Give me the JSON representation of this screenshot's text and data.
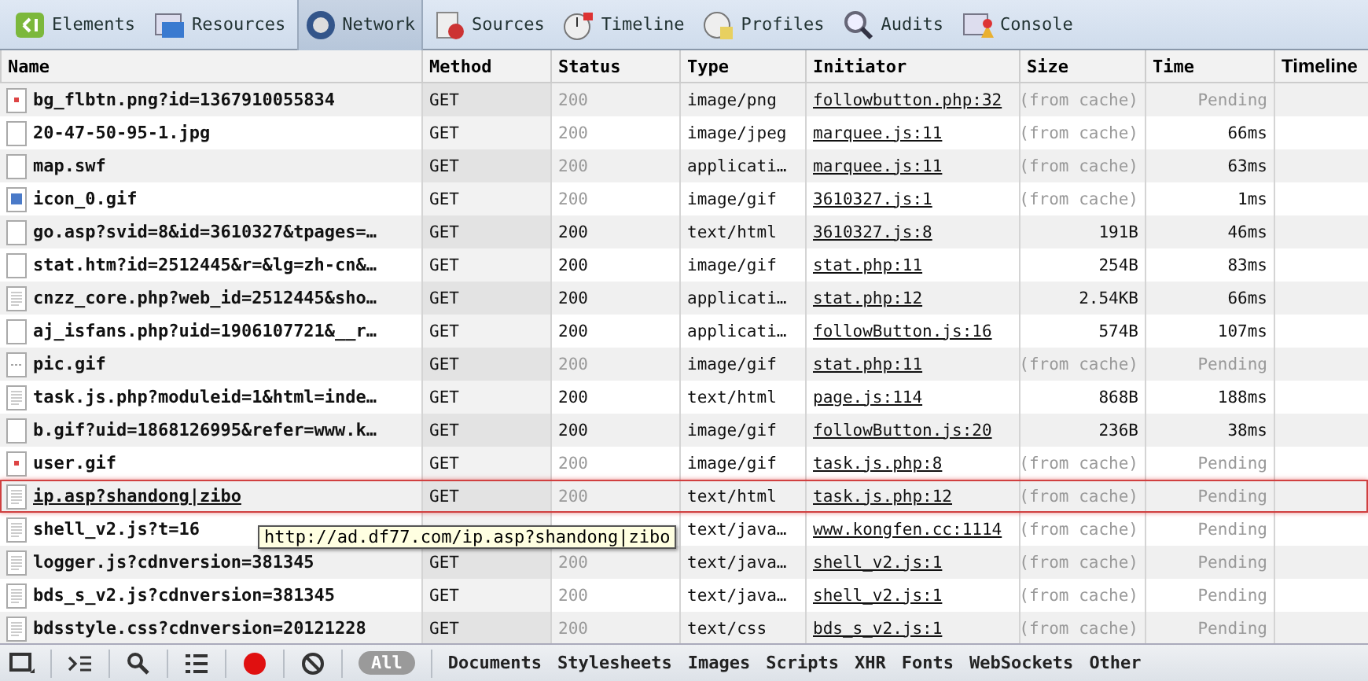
{
  "tabs": [
    {
      "label": "Elements",
      "selected": false
    },
    {
      "label": "Resources",
      "selected": false
    },
    {
      "label": "Network",
      "selected": true
    },
    {
      "label": "Sources",
      "selected": false
    },
    {
      "label": "Timeline",
      "selected": false
    },
    {
      "label": "Profiles",
      "selected": false
    },
    {
      "label": "Audits",
      "selected": false
    },
    {
      "label": "Console",
      "selected": false
    }
  ],
  "table": {
    "columns": [
      "Name",
      "Method",
      "Status",
      "Type",
      "Initiator",
      "Size",
      "Time",
      "Timeline"
    ],
    "rows": [
      {
        "kind": "image",
        "name": "bg_flbtn.png?id=1367910055834",
        "method": "GET",
        "status": "200",
        "type": "image/png",
        "initiator": "followbutton.php:32",
        "size": "(from cache)",
        "time": "Pending",
        "from_cache": true,
        "pending": true,
        "selected": false
      },
      {
        "kind": "blank",
        "name": "20-47-50-95-1.jpg",
        "method": "GET",
        "status": "200",
        "type": "image/jpeg",
        "initiator": "marquee.js:11",
        "size": "(from cache)",
        "time": "66ms",
        "from_cache": true,
        "pending": false,
        "selected": false
      },
      {
        "kind": "blank",
        "name": "map.swf",
        "method": "GET",
        "status": "200",
        "type": "applicati…",
        "initiator": "marquee.js:11",
        "size": "(from cache)",
        "time": "63ms",
        "from_cache": true,
        "pending": false,
        "selected": false
      },
      {
        "kind": "picture",
        "name": "icon_0.gif",
        "method": "GET",
        "status": "200",
        "type": "image/gif",
        "initiator": "3610327.js:1",
        "size": "(from cache)",
        "time": "1ms",
        "from_cache": true,
        "pending": false,
        "selected": false
      },
      {
        "kind": "blank",
        "name": "go.asp?svid=8&id=3610327&tpages=…",
        "method": "GET",
        "status": "200",
        "type": "text/html",
        "initiator": "3610327.js:8",
        "size": "191B",
        "time": "46ms",
        "from_cache": false,
        "pending": false,
        "selected": false
      },
      {
        "kind": "blank",
        "name": "stat.htm?id=2512445&r=&lg=zh-cn&…",
        "method": "GET",
        "status": "200",
        "type": "image/gif",
        "initiator": "stat.php:11",
        "size": "254B",
        "time": "83ms",
        "from_cache": false,
        "pending": false,
        "selected": false
      },
      {
        "kind": "document",
        "name": "cnzz_core.php?web_id=2512445&sho…",
        "method": "GET",
        "status": "200",
        "type": "applicati…",
        "initiator": "stat.php:12",
        "size": "2.54KB",
        "time": "66ms",
        "from_cache": false,
        "pending": false,
        "selected": false
      },
      {
        "kind": "blank",
        "name": "aj_isfans.php?uid=1906107721&__r…",
        "method": "GET",
        "status": "200",
        "type": "applicati…",
        "initiator": "followButton.js:16",
        "size": "574B",
        "time": "107ms",
        "from_cache": false,
        "pending": false,
        "selected": false
      },
      {
        "kind": "dash",
        "name": "pic.gif",
        "method": "GET",
        "status": "200",
        "type": "image/gif",
        "initiator": "stat.php:11",
        "size": "(from cache)",
        "time": "Pending",
        "from_cache": true,
        "pending": true,
        "selected": false
      },
      {
        "kind": "document",
        "name": "task.js.php?moduleid=1&html=inde…",
        "method": "GET",
        "status": "200",
        "type": "text/html",
        "initiator": "page.js:114",
        "size": "868B",
        "time": "188ms",
        "from_cache": false,
        "pending": false,
        "selected": false
      },
      {
        "kind": "blank",
        "name": "b.gif?uid=1868126995&refer=www.k…",
        "method": "GET",
        "status": "200",
        "type": "image/gif",
        "initiator": "followButton.js:20",
        "size": "236B",
        "time": "38ms",
        "from_cache": false,
        "pending": false,
        "selected": false
      },
      {
        "kind": "image",
        "name": "user.gif",
        "method": "GET",
        "status": "200",
        "type": "image/gif",
        "initiator": "task.js.php:8",
        "size": "(from cache)",
        "time": "Pending",
        "from_cache": true,
        "pending": true,
        "selected": false
      },
      {
        "kind": "document",
        "name": "ip.asp?shandong|zibo",
        "method": "GET",
        "status": "200",
        "type": "text/html",
        "initiator": "task.js.php:12",
        "size": "(from cache)",
        "time": "Pending",
        "from_cache": true,
        "pending": true,
        "selected": true
      },
      {
        "kind": "document",
        "name": "shell_v2.js?t=16",
        "type": "text/java…",
        "initiator": "www.kongfen.cc:1114",
        "size": "(from cache)",
        "time": "Pending",
        "from_cache": true,
        "pending": true,
        "selected": false
      },
      {
        "kind": "document",
        "name": "logger.js?cdnversion=381345",
        "method": "GET",
        "status": "200",
        "type": "text/java…",
        "initiator": "shell_v2.js:1",
        "size": "(from cache)",
        "time": "Pending",
        "from_cache": true,
        "pending": true,
        "selected": false
      },
      {
        "kind": "document",
        "name": "bds_s_v2.js?cdnversion=381345",
        "method": "GET",
        "status": "200",
        "type": "text/java…",
        "initiator": "shell_v2.js:1",
        "size": "(from cache)",
        "time": "Pending",
        "from_cache": true,
        "pending": true,
        "selected": false
      },
      {
        "kind": "document",
        "name": "bdsstyle.css?cdnversion=20121228",
        "method": "GET",
        "status": "200",
        "type": "text/css",
        "initiator": "bds_s_v2.js:1",
        "size": "(from cache)",
        "time": "Pending",
        "from_cache": true,
        "pending": true,
        "selected": false
      }
    ]
  },
  "tooltip": "http://ad.df77.com/ip.asp?shandong|zibo",
  "filters": [
    {
      "label": "All",
      "selected": true
    },
    {
      "label": "Documents",
      "selected": false
    },
    {
      "label": "Stylesheets",
      "selected": false
    },
    {
      "label": "Images",
      "selected": false
    },
    {
      "label": "Scripts",
      "selected": false
    },
    {
      "label": "XHR",
      "selected": false
    },
    {
      "label": "Fonts",
      "selected": false
    },
    {
      "label": "WebSockets",
      "selected": false
    },
    {
      "label": "Other",
      "selected": false
    }
  ]
}
